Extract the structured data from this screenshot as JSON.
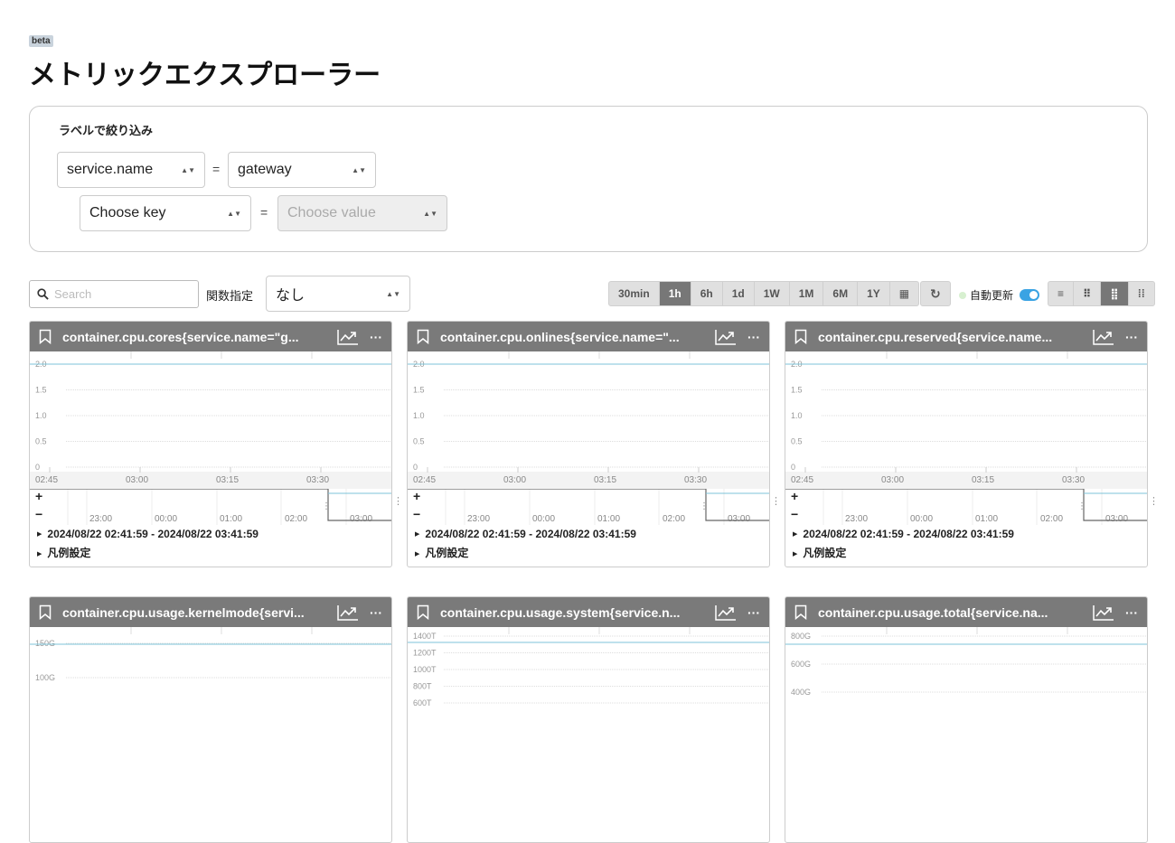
{
  "badge": "beta",
  "title": "メトリックエクスプローラー",
  "filter": {
    "label": "ラベルで絞り込み",
    "rows": [
      {
        "key": "service.name",
        "value": "gateway",
        "eq": "="
      },
      {
        "key": "Choose key",
        "value": "Choose value",
        "eq": "="
      }
    ]
  },
  "toolbar": {
    "search_placeholder": "Search",
    "function_label": "関数指定",
    "function_value": "なし",
    "ranges": [
      "30min",
      "1h",
      "6h",
      "1d",
      "1W",
      "1M",
      "6M",
      "1Y"
    ],
    "active_range": "1h",
    "auto_refresh": "自動更新",
    "auto_refresh_on": true
  },
  "colors": {
    "header": "#7a7a7a",
    "series": "#7cc3d8",
    "active": "#777777"
  },
  "panels": [
    {
      "title": "container.cpu.cores{service.name=\"g...",
      "yticks": [
        "2.0",
        "1.5",
        "1.0",
        "0.5",
        "0"
      ],
      "xticks": [
        "02:45",
        "03:00",
        "03:15",
        "03:30"
      ],
      "navticks": [
        "23:00",
        "00:00",
        "01:00",
        "02:00",
        "03:00"
      ],
      "range": "2024/08/22 02:41:59 - 2024/08/22 03:41:59",
      "legend": "凡例設定",
      "value": 2.0,
      "ymax": 2.0
    },
    {
      "title": "container.cpu.onlines{service.name=\"...",
      "yticks": [
        "2.0",
        "1.5",
        "1.0",
        "0.5",
        "0"
      ],
      "xticks": [
        "02:45",
        "03:00",
        "03:15",
        "03:30"
      ],
      "navticks": [
        "23:00",
        "00:00",
        "01:00",
        "02:00",
        "03:00"
      ],
      "range": "2024/08/22 02:41:59 - 2024/08/22 03:41:59",
      "legend": "凡例設定",
      "value": 2.0,
      "ymax": 2.0
    },
    {
      "title": "container.cpu.reserved{service.name...",
      "yticks": [
        "2.0",
        "1.5",
        "1.0",
        "0.5",
        "0"
      ],
      "xticks": [
        "02:45",
        "03:00",
        "03:15",
        "03:30"
      ],
      "navticks": [
        "23:00",
        "00:00",
        "01:00",
        "02:00",
        "03:00"
      ],
      "range": "2024/08/22 02:41:59 - 2024/08/22 03:41:59",
      "legend": "凡例設定",
      "value": 2.0,
      "ymax": 2.0
    },
    {
      "title": "container.cpu.usage.kernelmode{servi...",
      "yticks": [
        "150G",
        "100G"
      ],
      "xticks": [],
      "navticks": [],
      "range": "",
      "legend": ""
    },
    {
      "title": "container.cpu.usage.system{service.n...",
      "yticks": [
        "1400T",
        "1200T",
        "1000T",
        "800T",
        "600T"
      ],
      "xticks": [],
      "navticks": [],
      "range": "",
      "legend": ""
    },
    {
      "title": "container.cpu.usage.total{service.na...",
      "yticks": [
        "800G",
        "600G",
        "400G"
      ],
      "xticks": [],
      "navticks": [],
      "range": "",
      "legend": ""
    }
  ]
}
